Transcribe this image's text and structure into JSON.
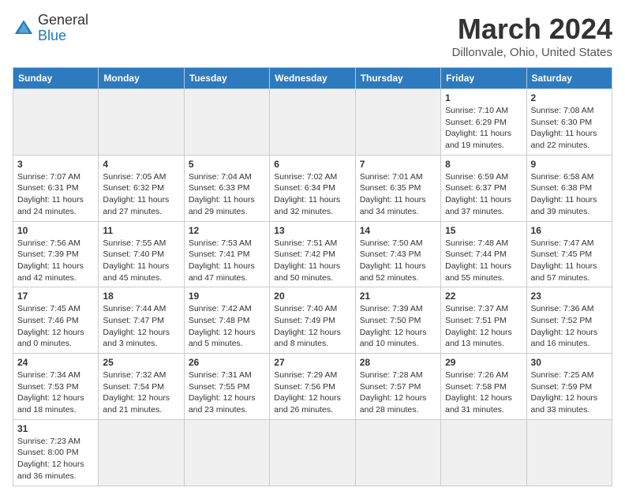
{
  "header": {
    "logo_general": "General",
    "logo_blue": "Blue",
    "title": "March 2024",
    "subtitle": "Dillonvale, Ohio, United States"
  },
  "weekdays": [
    "Sunday",
    "Monday",
    "Tuesday",
    "Wednesday",
    "Thursday",
    "Friday",
    "Saturday"
  ],
  "weeks": [
    [
      {
        "day": "",
        "info": "",
        "empty": true
      },
      {
        "day": "",
        "info": "",
        "empty": true
      },
      {
        "day": "",
        "info": "",
        "empty": true
      },
      {
        "day": "",
        "info": "",
        "empty": true
      },
      {
        "day": "",
        "info": "",
        "empty": true
      },
      {
        "day": "1",
        "info": "Sunrise: 7:10 AM\nSunset: 6:29 PM\nDaylight: 11 hours\nand 19 minutes."
      },
      {
        "day": "2",
        "info": "Sunrise: 7:08 AM\nSunset: 6:30 PM\nDaylight: 11 hours\nand 22 minutes."
      }
    ],
    [
      {
        "day": "3",
        "info": "Sunrise: 7:07 AM\nSunset: 6:31 PM\nDaylight: 11 hours\nand 24 minutes."
      },
      {
        "day": "4",
        "info": "Sunrise: 7:05 AM\nSunset: 6:32 PM\nDaylight: 11 hours\nand 27 minutes."
      },
      {
        "day": "5",
        "info": "Sunrise: 7:04 AM\nSunset: 6:33 PM\nDaylight: 11 hours\nand 29 minutes."
      },
      {
        "day": "6",
        "info": "Sunrise: 7:02 AM\nSunset: 6:34 PM\nDaylight: 11 hours\nand 32 minutes."
      },
      {
        "day": "7",
        "info": "Sunrise: 7:01 AM\nSunset: 6:35 PM\nDaylight: 11 hours\nand 34 minutes."
      },
      {
        "day": "8",
        "info": "Sunrise: 6:59 AM\nSunset: 6:37 PM\nDaylight: 11 hours\nand 37 minutes."
      },
      {
        "day": "9",
        "info": "Sunrise: 6:58 AM\nSunset: 6:38 PM\nDaylight: 11 hours\nand 39 minutes."
      }
    ],
    [
      {
        "day": "10",
        "info": "Sunrise: 7:56 AM\nSunset: 7:39 PM\nDaylight: 11 hours\nand 42 minutes."
      },
      {
        "day": "11",
        "info": "Sunrise: 7:55 AM\nSunset: 7:40 PM\nDaylight: 11 hours\nand 45 minutes."
      },
      {
        "day": "12",
        "info": "Sunrise: 7:53 AM\nSunset: 7:41 PM\nDaylight: 11 hours\nand 47 minutes."
      },
      {
        "day": "13",
        "info": "Sunrise: 7:51 AM\nSunset: 7:42 PM\nDaylight: 11 hours\nand 50 minutes."
      },
      {
        "day": "14",
        "info": "Sunrise: 7:50 AM\nSunset: 7:43 PM\nDaylight: 11 hours\nand 52 minutes."
      },
      {
        "day": "15",
        "info": "Sunrise: 7:48 AM\nSunset: 7:44 PM\nDaylight: 11 hours\nand 55 minutes."
      },
      {
        "day": "16",
        "info": "Sunrise: 7:47 AM\nSunset: 7:45 PM\nDaylight: 11 hours\nand 57 minutes."
      }
    ],
    [
      {
        "day": "17",
        "info": "Sunrise: 7:45 AM\nSunset: 7:46 PM\nDaylight: 12 hours\nand 0 minutes."
      },
      {
        "day": "18",
        "info": "Sunrise: 7:44 AM\nSunset: 7:47 PM\nDaylight: 12 hours\nand 3 minutes."
      },
      {
        "day": "19",
        "info": "Sunrise: 7:42 AM\nSunset: 7:48 PM\nDaylight: 12 hours\nand 5 minutes."
      },
      {
        "day": "20",
        "info": "Sunrise: 7:40 AM\nSunset: 7:49 PM\nDaylight: 12 hours\nand 8 minutes."
      },
      {
        "day": "21",
        "info": "Sunrise: 7:39 AM\nSunset: 7:50 PM\nDaylight: 12 hours\nand 10 minutes."
      },
      {
        "day": "22",
        "info": "Sunrise: 7:37 AM\nSunset: 7:51 PM\nDaylight: 12 hours\nand 13 minutes."
      },
      {
        "day": "23",
        "info": "Sunrise: 7:36 AM\nSunset: 7:52 PM\nDaylight: 12 hours\nand 16 minutes."
      }
    ],
    [
      {
        "day": "24",
        "info": "Sunrise: 7:34 AM\nSunset: 7:53 PM\nDaylight: 12 hours\nand 18 minutes."
      },
      {
        "day": "25",
        "info": "Sunrise: 7:32 AM\nSunset: 7:54 PM\nDaylight: 12 hours\nand 21 minutes."
      },
      {
        "day": "26",
        "info": "Sunrise: 7:31 AM\nSunset: 7:55 PM\nDaylight: 12 hours\nand 23 minutes."
      },
      {
        "day": "27",
        "info": "Sunrise: 7:29 AM\nSunset: 7:56 PM\nDaylight: 12 hours\nand 26 minutes."
      },
      {
        "day": "28",
        "info": "Sunrise: 7:28 AM\nSunset: 7:57 PM\nDaylight: 12 hours\nand 28 minutes."
      },
      {
        "day": "29",
        "info": "Sunrise: 7:26 AM\nSunset: 7:58 PM\nDaylight: 12 hours\nand 31 minutes."
      },
      {
        "day": "30",
        "info": "Sunrise: 7:25 AM\nSunset: 7:59 PM\nDaylight: 12 hours\nand 33 minutes."
      }
    ],
    [
      {
        "day": "31",
        "info": "Sunrise: 7:23 AM\nSunset: 8:00 PM\nDaylight: 12 hours\nand 36 minutes."
      },
      {
        "day": "",
        "info": "",
        "empty": true
      },
      {
        "day": "",
        "info": "",
        "empty": true
      },
      {
        "day": "",
        "info": "",
        "empty": true
      },
      {
        "day": "",
        "info": "",
        "empty": true
      },
      {
        "day": "",
        "info": "",
        "empty": true
      },
      {
        "day": "",
        "info": "",
        "empty": true
      }
    ]
  ]
}
